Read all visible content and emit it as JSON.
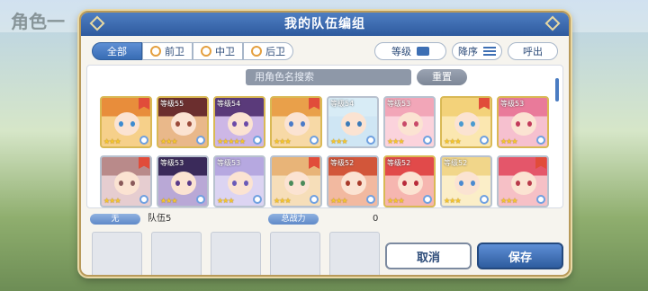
{
  "background": {
    "title": "角色一"
  },
  "dialog": {
    "title": "我的队伍编组"
  },
  "filters": {
    "tabs": [
      {
        "label": "全部",
        "active": true
      },
      {
        "label": "前卫",
        "active": false
      },
      {
        "label": "中卫",
        "active": false
      },
      {
        "label": "后卫",
        "active": false
      }
    ],
    "level_label": "等级",
    "sort_label": "降序",
    "call_label": "呼出"
  },
  "search": {
    "placeholder": "用角色名搜索",
    "reset_label": "重置"
  },
  "characters": [
    {
      "level": "",
      "stars": "★★★",
      "frame": "gold",
      "flag": true,
      "hair": "#e88d3b",
      "bg": "#f6d08a",
      "eye": "#3c8bd0"
    },
    {
      "level": "等级55",
      "stars": "★★★",
      "frame": "gold",
      "flag": false,
      "hair": "#6b2e2e",
      "bg": "#e9b88a",
      "eye": "#9a4a3a"
    },
    {
      "level": "等级54",
      "stars": "★★★★★",
      "frame": "gold",
      "flag": false,
      "hair": "#5a3a7a",
      "bg": "#cdb7e6",
      "eye": "#6b4aa8"
    },
    {
      "level": "",
      "stars": "★★★",
      "frame": "gold",
      "flag": true,
      "hair": "#e9a04a",
      "bg": "#f7d9a6",
      "eye": "#4a7ac8"
    },
    {
      "level": "等级54",
      "stars": "★★★",
      "frame": "silver",
      "flag": false,
      "hair": "#d8ecf6",
      "bg": "#cfe6f4",
      "eye": "#3a7ab8"
    },
    {
      "level": "等级53",
      "stars": "★★★",
      "frame": "silver",
      "flag": false,
      "hair": "#f2a6b8",
      "bg": "#fbd3dc",
      "eye": "#c84a6a"
    },
    {
      "level": "",
      "stars": "★★★",
      "frame": "gold",
      "flag": true,
      "hair": "#f3d27a",
      "bg": "#fbe7b0",
      "eye": "#4a9ad0"
    },
    {
      "level": "等级53",
      "stars": "★★★",
      "frame": "gold",
      "flag": false,
      "hair": "#e97a9a",
      "bg": "#f6c0cf",
      "eye": "#c23a5a"
    },
    {
      "level": "",
      "stars": "★★★",
      "frame": "silver",
      "flag": true,
      "hair": "#b98a8a",
      "bg": "#e6cdd0",
      "eye": "#8a5a5a"
    },
    {
      "level": "等级53",
      "stars": "★★★",
      "frame": "silver",
      "flag": false,
      "hair": "#3a2a5a",
      "bg": "#b9a8d6",
      "eye": "#5a3a8a"
    },
    {
      "level": "等级53",
      "stars": "★★★",
      "frame": "silver",
      "flag": false,
      "hair": "#b6a8e0",
      "bg": "#dcd4f2",
      "eye": "#6a5ab8"
    },
    {
      "level": "",
      "stars": "★★★",
      "frame": "silver",
      "flag": true,
      "hair": "#e8b478",
      "bg": "#f6deb9",
      "eye": "#4a8a5a"
    },
    {
      "level": "等级52",
      "stars": "★★★",
      "frame": "silver",
      "flag": false,
      "hair": "#d2563a",
      "bg": "#f2b9a0",
      "eye": "#a83a2a"
    },
    {
      "level": "等级52",
      "stars": "★★★",
      "frame": "gold",
      "flag": false,
      "hair": "#e14a4a",
      "bg": "#f6b6b0",
      "eye": "#b82a3a"
    },
    {
      "level": "等级52",
      "stars": "★★★",
      "frame": "silver",
      "flag": false,
      "hair": "#f1d68a",
      "bg": "#fbeec8",
      "eye": "#4a8ad0"
    },
    {
      "level": "",
      "stars": "★★★",
      "frame": "silver",
      "flag": true,
      "hair": "#e4566a",
      "bg": "#f6c0c6",
      "eye": "#b83a4a"
    }
  ],
  "party": {
    "tag": "无",
    "label": "队伍5",
    "power_label": "总战力",
    "power_value": "0"
  },
  "actions": {
    "cancel_label": "取消",
    "save_label": "保存"
  }
}
